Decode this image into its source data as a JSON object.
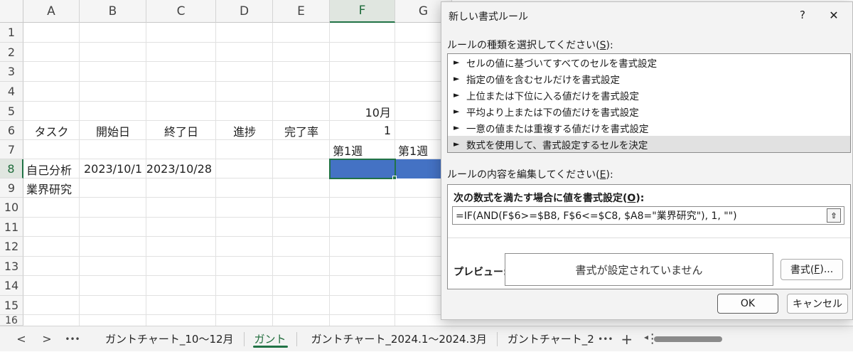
{
  "sheet": {
    "columns": [
      "A",
      "B",
      "C",
      "D",
      "E",
      "F",
      "G"
    ],
    "rows": [
      "1",
      "2",
      "3",
      "4",
      "5",
      "6",
      "7",
      "8",
      "9",
      "10",
      "11",
      "12",
      "13",
      "14",
      "15",
      "16"
    ],
    "cells": {
      "E5_month": "10月",
      "F6": "1",
      "A6": "タスク",
      "B6": "開始日",
      "C6": "終了日",
      "D6": "進捗",
      "E6": "完了率",
      "F7": "第1週",
      "G7": "第1週",
      "A8": "自己分析",
      "B8": "2023/10/1",
      "C8": "2023/10/28",
      "A9": "業界研究"
    },
    "fill_color": "#4472c4",
    "selected_column": "F",
    "selected_row": "8"
  },
  "tabbar": {
    "prev": "<",
    "next": ">",
    "more_left": "•••",
    "tabs": [
      "ガントチャート_10～12月",
      "ガント",
      "ガントチャート_2024.1～2024.3月",
      "ガントチャート_2"
    ],
    "active_tab": "ガント",
    "more_right": "•••",
    "add": "+",
    "options": "⋮",
    "scroll_left": "◂"
  },
  "dialog": {
    "title": "新しい書式ルール",
    "help": "?",
    "close": "✕",
    "rule_type_label": "ルールの種類を選択してください(",
    "rule_type_key": "S",
    "rule_type_suffix": "):",
    "rule_types": [
      "セルの値に基づいてすべてのセルを書式設定",
      "指定の値を含むセルだけを書式設定",
      "上位または下位に入る値だけを書式設定",
      "平均より上または下の値だけを書式設定",
      "一意の値または重複する値だけを書式設定",
      "数式を使用して、書式設定するセルを決定"
    ],
    "selected_rule_index": 5,
    "rule_arrow": "►",
    "edit_label": "ルールの内容を編集してください(",
    "edit_key": "E",
    "edit_suffix": "):",
    "formula_label": "次の数式を満たす場合に値を書式設定(",
    "formula_key": "O",
    "formula_suffix": "):",
    "formula_value": "=IF(AND(F$6>=$B8, F$6<=$C8, $A8=\"業界研究\"), 1, \"\")",
    "collapse_icon": "⇧",
    "preview_label": "プレビュー:",
    "preview_text": "書式が設定されていません",
    "format_button_prefix": "書式(",
    "format_button_key": "F",
    "format_button_suffix": ")...",
    "ok": "OK",
    "cancel": "キャンセル"
  }
}
